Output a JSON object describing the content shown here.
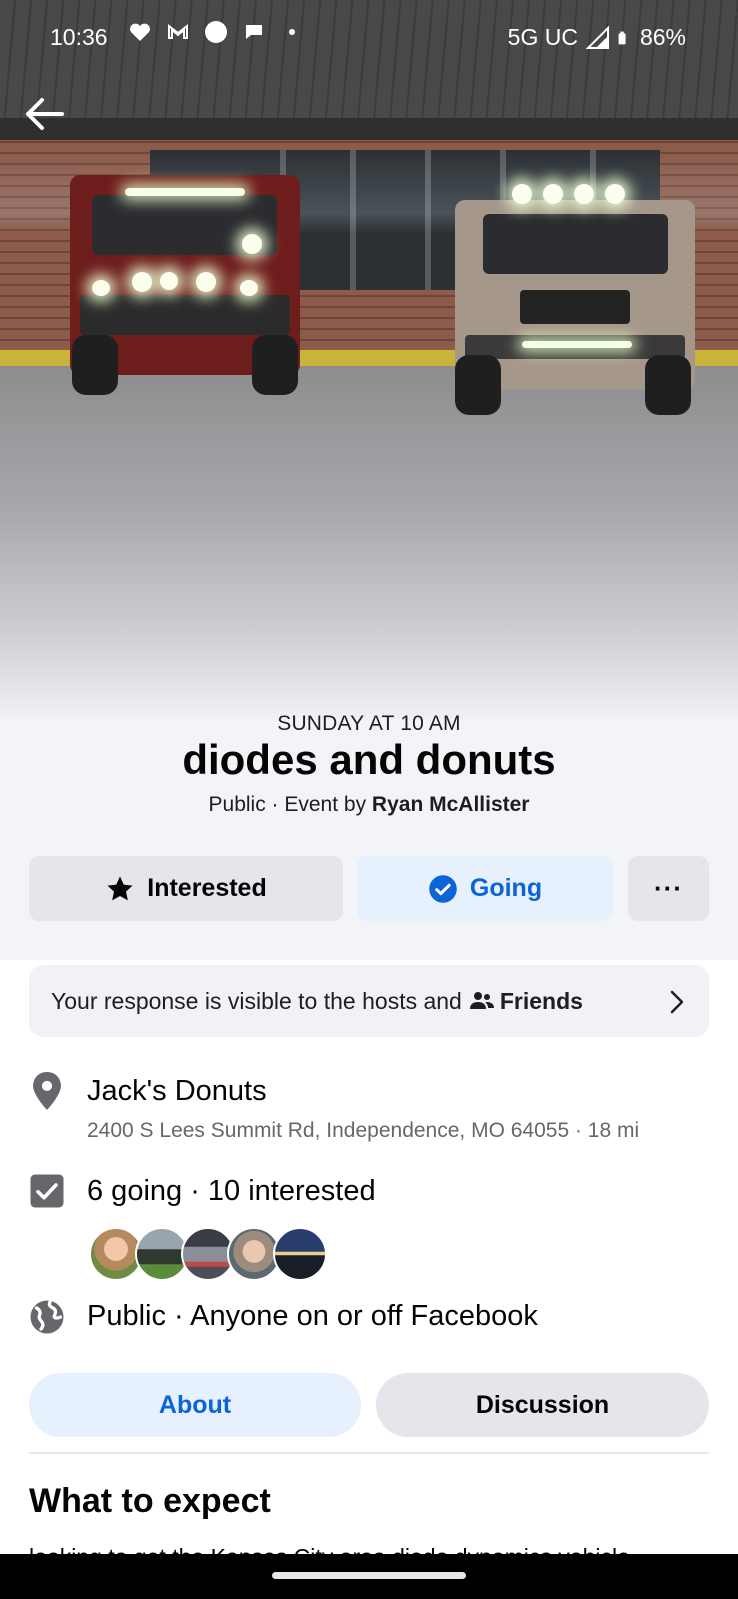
{
  "status_bar": {
    "time": "10:36",
    "network": "5G UC",
    "battery": "86%",
    "left_icons": [
      "heart-shield-icon",
      "gmail-icon",
      "circle-icon",
      "chat-bubble-icon",
      "dot-icon"
    ],
    "right_icons": [
      "signal-icon",
      "battery-icon"
    ]
  },
  "navigation": {
    "back_icon": "arrow-left-icon"
  },
  "event": {
    "date": "SUNDAY AT 10 AM",
    "title": "diodes and donuts",
    "visibility_prefix": "Public · Event by ",
    "host": "Ryan McAllister"
  },
  "actions": {
    "interested_label": "Interested",
    "going_label": "Going",
    "more_label": "···"
  },
  "response_notice": {
    "text": "Your response is visible to the hosts and",
    "audience": "Friends"
  },
  "details": {
    "location_name": "Jack's Donuts",
    "location_address": "2400 S Lees Summit Rd, Independence, MO 64055 · 18 mi",
    "attendance": "6 going · 10 interested",
    "privacy": "Public · Anyone on or off Facebook",
    "attendee_avatar_count": 5
  },
  "tabs": {
    "about": "About",
    "discussion": "Discussion"
  },
  "about": {
    "section_title": "What to expect",
    "snippet": "looking to get the Kansas City area diode dynamics vehicle"
  },
  "colors": {
    "accent_blue": "#0b64d8",
    "accent_light": "#e7f0fd",
    "button_gray": "#e4e6eb",
    "secondary_text": "#65676b"
  }
}
